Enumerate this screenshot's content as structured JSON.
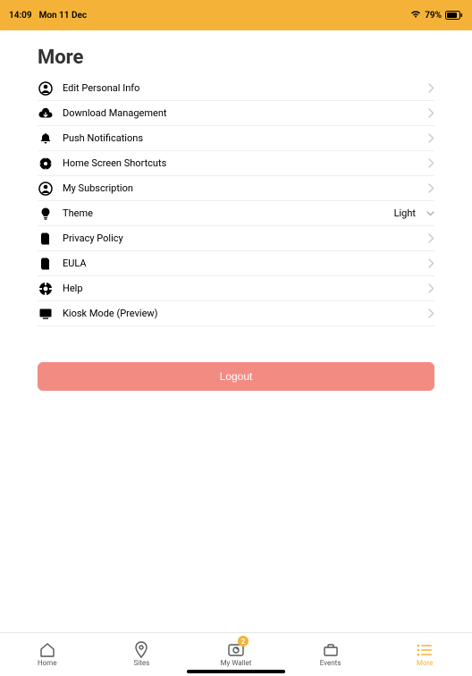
{
  "status_bar": {
    "time": "14:09",
    "date": "Mon 11 Dec",
    "battery_percent": "79%"
  },
  "page": {
    "title": "More"
  },
  "menu": {
    "items": [
      {
        "id": "edit-personal-info",
        "icon": "person-circle-icon",
        "label": "Edit Personal Info",
        "accessory": "chevron"
      },
      {
        "id": "download-management",
        "icon": "cloud-download-icon",
        "label": "Download Management",
        "accessory": "chevron"
      },
      {
        "id": "push-notifications",
        "icon": "bell-icon",
        "label": "Push Notifications",
        "accessory": "chevron"
      },
      {
        "id": "home-screen-shortcuts",
        "icon": "gear-icon",
        "label": "Home Screen Shortcuts",
        "accessory": "chevron"
      },
      {
        "id": "my-subscription",
        "icon": "person-circle-icon",
        "label": "My Subscription",
        "accessory": "chevron"
      },
      {
        "id": "theme",
        "icon": "lightbulb-icon",
        "label": "Theme",
        "value": "Light",
        "accessory": "dropdown"
      },
      {
        "id": "privacy-policy",
        "icon": "document-icon",
        "label": "Privacy Policy",
        "accessory": "chevron"
      },
      {
        "id": "eula",
        "icon": "document-icon",
        "label": "EULA",
        "accessory": "chevron"
      },
      {
        "id": "help",
        "icon": "help-icon",
        "label": "Help",
        "accessory": "chevron"
      },
      {
        "id": "kiosk-mode",
        "icon": "monitor-icon",
        "label": "Kiosk Mode (Preview)",
        "accessory": "chevron"
      }
    ]
  },
  "logout": {
    "label": "Logout"
  },
  "tabs": {
    "items": [
      {
        "id": "home",
        "icon": "home-icon",
        "label": "Home",
        "active": false
      },
      {
        "id": "sites",
        "icon": "pin-icon",
        "label": "Sites",
        "active": false
      },
      {
        "id": "my-wallet",
        "icon": "wallet-icon",
        "label": "My Wallet",
        "active": false,
        "badge": "2"
      },
      {
        "id": "events",
        "icon": "briefcase-icon",
        "label": "Events",
        "active": false
      },
      {
        "id": "more",
        "icon": "menu-icon",
        "label": "More",
        "active": true
      }
    ]
  },
  "colors": {
    "accent_orange": "#f4b338",
    "logout_red": "#f28b82"
  }
}
